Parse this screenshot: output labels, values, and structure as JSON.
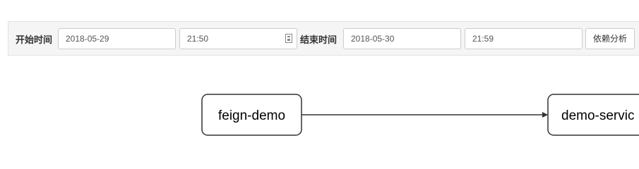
{
  "toolbar": {
    "start_label": "开始时间",
    "start_date": "2018-05-29",
    "start_time": "21:50",
    "end_label": "结束时间",
    "end_date": "2018-05-30",
    "end_time": "21:59",
    "analyze_button": "依赖分析"
  },
  "graph": {
    "nodes": [
      {
        "id": "feign-demo",
        "label": "feign-demo"
      },
      {
        "id": "demo-service",
        "label": "demo-servic"
      }
    ],
    "edges": [
      {
        "from": "feign-demo",
        "to": "demo-service"
      }
    ],
    "stroke_color": "#333333"
  }
}
